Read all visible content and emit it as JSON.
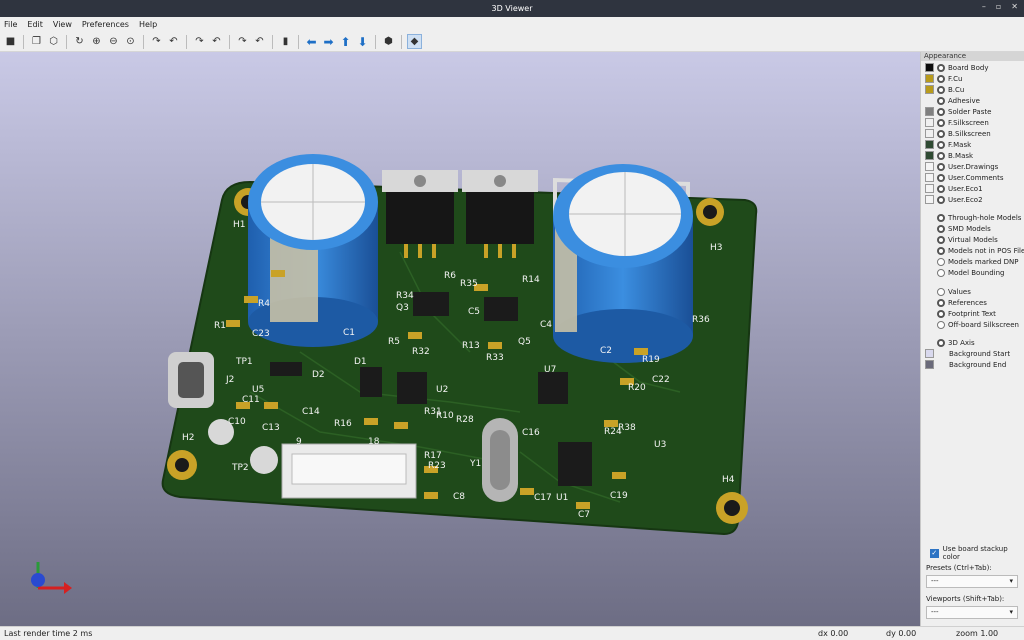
{
  "window": {
    "title": "3D Viewer"
  },
  "menu": [
    "File",
    "Edit",
    "View",
    "Preferences",
    "Help"
  ],
  "toolbar": {
    "icons": [
      "render-raytracing-icon",
      "copy-image-icon",
      "3d-preferences-icon",
      "reload-icon",
      "zoom-in-icon",
      "zoom-out-icon",
      "zoom-fit-icon",
      "rotate-x-cw-icon",
      "rotate-x-ccw-icon",
      "rotate-y-cw-icon",
      "rotate-y-ccw-icon",
      "rotate-z-cw-icon",
      "rotate-z-ccw-icon",
      "flip-board-icon",
      "move-left-icon",
      "move-right-icon",
      "move-up-icon",
      "move-down-icon",
      "orthographic-icon",
      "toggle-appearance-panel-icon"
    ]
  },
  "appearance": {
    "title": "Appearance",
    "layers": [
      {
        "name": "Board Body",
        "color": "#0d0d0d",
        "visible": true
      },
      {
        "name": "F.Cu",
        "color": "#b89b1c",
        "visible": true
      },
      {
        "name": "B.Cu",
        "color": "#b89b1c",
        "visible": true
      },
      {
        "name": "Adhesive",
        "color": "",
        "visible": true
      },
      {
        "name": "Solder Paste",
        "color": "#808080",
        "visible": true
      },
      {
        "name": "F.Silkscreen",
        "color": "#f0f0f0",
        "visible": true
      },
      {
        "name": "B.Silkscreen",
        "color": "#f0f0f0",
        "visible": true
      },
      {
        "name": "F.Mask",
        "color": "#2f4a32",
        "visible": true
      },
      {
        "name": "B.Mask",
        "color": "#2f4a32",
        "visible": true
      },
      {
        "name": "User.Drawings",
        "color": "",
        "visible": true
      },
      {
        "name": "User.Comments",
        "color": "",
        "visible": true
      },
      {
        "name": "User.Eco1",
        "color": "",
        "visible": true
      },
      {
        "name": "User.Eco2",
        "color": "",
        "visible": true
      }
    ],
    "objects": [
      {
        "name": "Through-hole Models",
        "visible": true
      },
      {
        "name": "SMD Models",
        "visible": true
      },
      {
        "name": "Virtual Models",
        "visible": true
      },
      {
        "name": "Models not in POS File",
        "visible": true
      },
      {
        "name": "Models marked DNP",
        "visible": false
      },
      {
        "name": "Model Bounding",
        "visible": false
      }
    ],
    "text_items": [
      {
        "name": "Values",
        "visible": false
      },
      {
        "name": "References",
        "visible": true
      },
      {
        "name": "Footprint Text",
        "visible": true
      },
      {
        "name": "Off-board Silkscreen",
        "visible": false
      }
    ],
    "misc": [
      {
        "name": "3D Axis",
        "visible": true
      },
      {
        "name": "Background Start",
        "color": "#d9d9ee"
      },
      {
        "name": "Background End",
        "color": "#6a6a7a"
      }
    ],
    "use_stackup_color": "Use board stackup color",
    "presets_label": "Presets (Ctrl+Tab):",
    "presets_value": "---",
    "viewports_label": "Viewports (Shift+Tab):",
    "viewports_value": "---"
  },
  "status": {
    "render_time": "Last render time 2 ms",
    "dx": "dx 0.00",
    "dy": "dy 0.00",
    "zoom": "zoom 1.00"
  },
  "board": {
    "references": [
      "H1",
      "H2",
      "H3",
      "H4",
      "C1",
      "C2",
      "C4",
      "C5",
      "C7",
      "C8",
      "C10",
      "C11",
      "C13",
      "C14",
      "C16",
      "C17",
      "C19",
      "C22",
      "C23",
      "D1",
      "D2",
      "Q3",
      "Q5",
      "R1",
      "R4",
      "R5",
      "R6",
      "R10",
      "R13",
      "R14",
      "R16",
      "R17",
      "R19",
      "R20",
      "R23",
      "R24",
      "R28",
      "R31",
      "R32",
      "R33",
      "R34",
      "R35",
      "R36",
      "R38",
      "U1",
      "U2",
      "U3",
      "U5",
      "U7",
      "Y1",
      "TP1",
      "TP2",
      "J2",
      "9",
      "18"
    ],
    "colors": {
      "pcb": "#1f4a1a",
      "pad": "#c9a227",
      "cap": "#2d7fcf",
      "silk": "#f4f4f4"
    }
  }
}
